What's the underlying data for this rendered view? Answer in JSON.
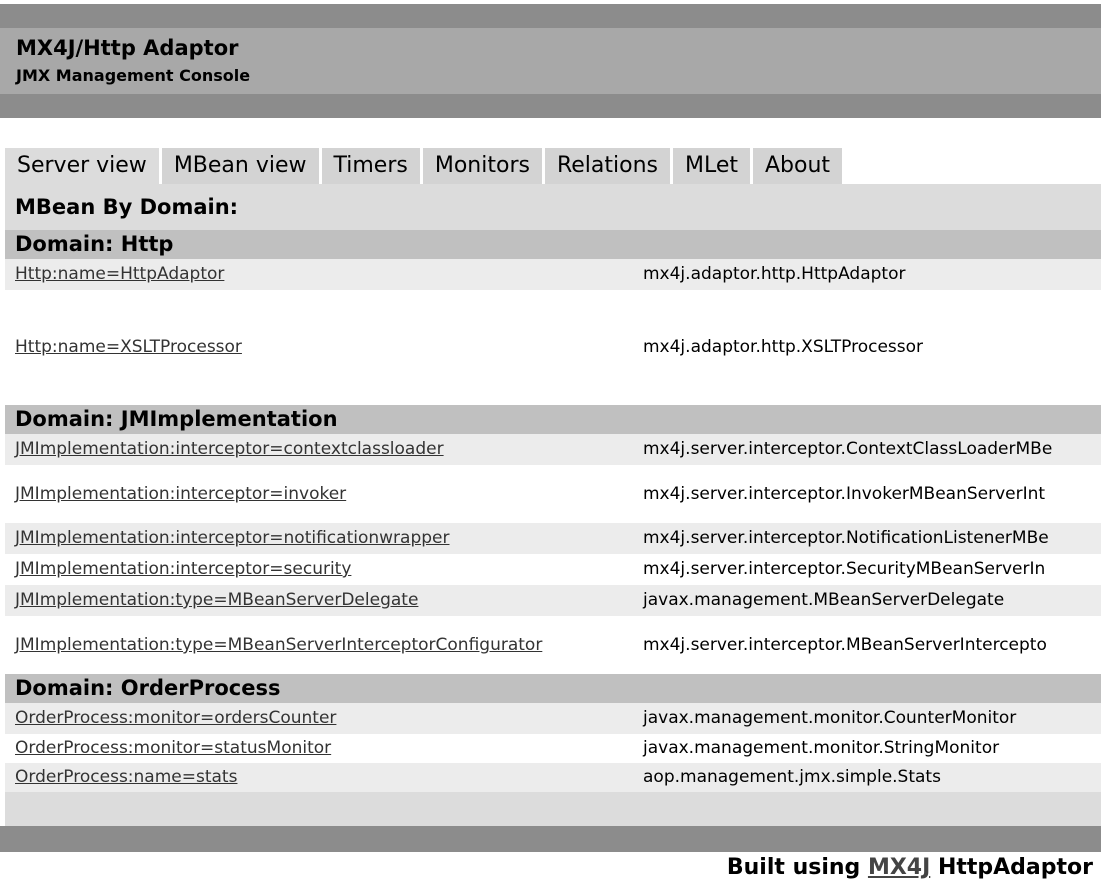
{
  "header": {
    "title": "MX4J/Http Adaptor",
    "subtitle": "JMX Management Console"
  },
  "tabs": [
    {
      "label": "Server view",
      "active": true
    },
    {
      "label": "MBean view"
    },
    {
      "label": "Timers"
    },
    {
      "label": "Monitors"
    },
    {
      "label": "Relations"
    },
    {
      "label": "MLet"
    },
    {
      "label": "About"
    }
  ],
  "section_title": "MBean By Domain:",
  "domains": [
    {
      "header": "Domain: Http",
      "rows": [
        {
          "name": "Http:name=HttpAdaptor",
          "class": "mx4j.adaptor.http.HttpAdaptor"
        },
        {
          "name": "Http:name=XSLTProcessor",
          "class": "mx4j.adaptor.http.XSLTProcessor"
        }
      ]
    },
    {
      "header": "Domain: JMImplementation",
      "rows": [
        {
          "name": "JMImplementation:interceptor=contextclassloader",
          "class": "mx4j.server.interceptor.ContextClassLoaderMBe"
        },
        {
          "name": "JMImplementation:interceptor=invoker",
          "class": "mx4j.server.interceptor.InvokerMBeanServerInt"
        },
        {
          "name": "JMImplementation:interceptor=notificationwrapper",
          "class": "mx4j.server.interceptor.NotificationListenerMBe"
        },
        {
          "name": "JMImplementation:interceptor=security",
          "class": "mx4j.server.interceptor.SecurityMBeanServerIn"
        },
        {
          "name": "JMImplementation:type=MBeanServerDelegate",
          "class": "javax.management.MBeanServerDelegate"
        },
        {
          "name": "JMImplementation:type=MBeanServerInterceptorConfigurator",
          "class": "mx4j.server.interceptor.MBeanServerIntercepto"
        }
      ]
    },
    {
      "header": "Domain: OrderProcess",
      "rows": [
        {
          "name": "OrderProcess:monitor=ordersCounter",
          "class": "javax.management.monitor.CounterMonitor"
        },
        {
          "name": "OrderProcess:monitor=statusMonitor",
          "class": "javax.management.monitor.StringMonitor"
        },
        {
          "name": "OrderProcess:name=stats",
          "class": "aop.management.jmx.simple.Stats"
        }
      ]
    }
  ],
  "footer": {
    "prefix": "Built using ",
    "link": "MX4J",
    "suffix": " HttpAdaptor"
  }
}
